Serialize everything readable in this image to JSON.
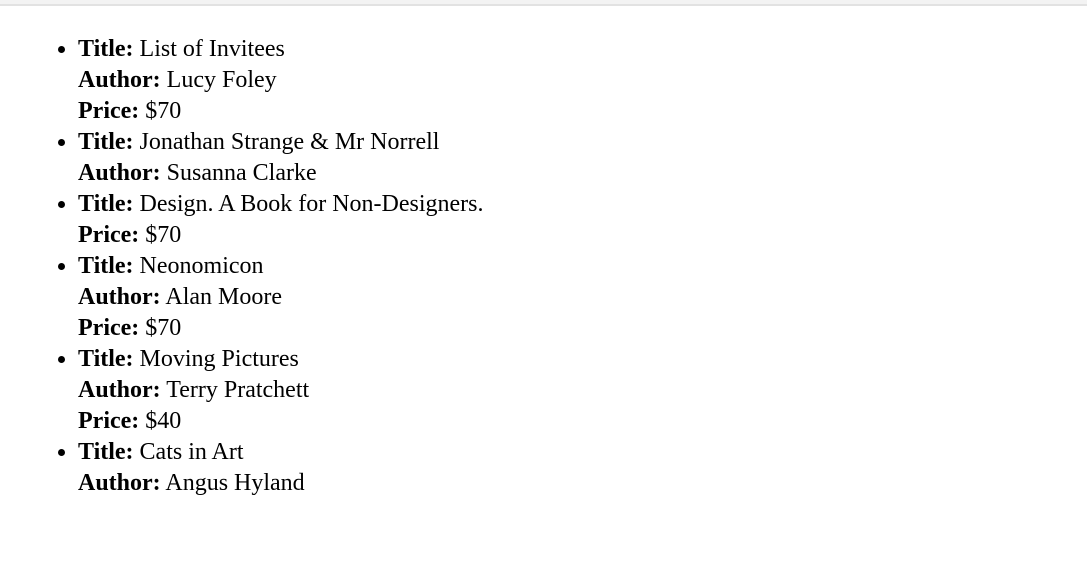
{
  "labels": {
    "title": "Title:",
    "author": "Author:",
    "price": "Price:"
  },
  "books": [
    {
      "title": "List of Invitees",
      "author": "Lucy Foley",
      "price": "$70"
    },
    {
      "title": "Jonathan Strange & Mr Norrell",
      "author": "Susanna Clarke"
    },
    {
      "title": "Design. A Book for Non-Designers.",
      "price": "$70"
    },
    {
      "title": "Neonomicon",
      "author": "Alan Moore",
      "price": "$70"
    },
    {
      "title": "Moving Pictures",
      "author": "Terry Pratchett",
      "price": "$40"
    },
    {
      "title": "Cats in Art",
      "author": "Angus Hyland"
    }
  ]
}
